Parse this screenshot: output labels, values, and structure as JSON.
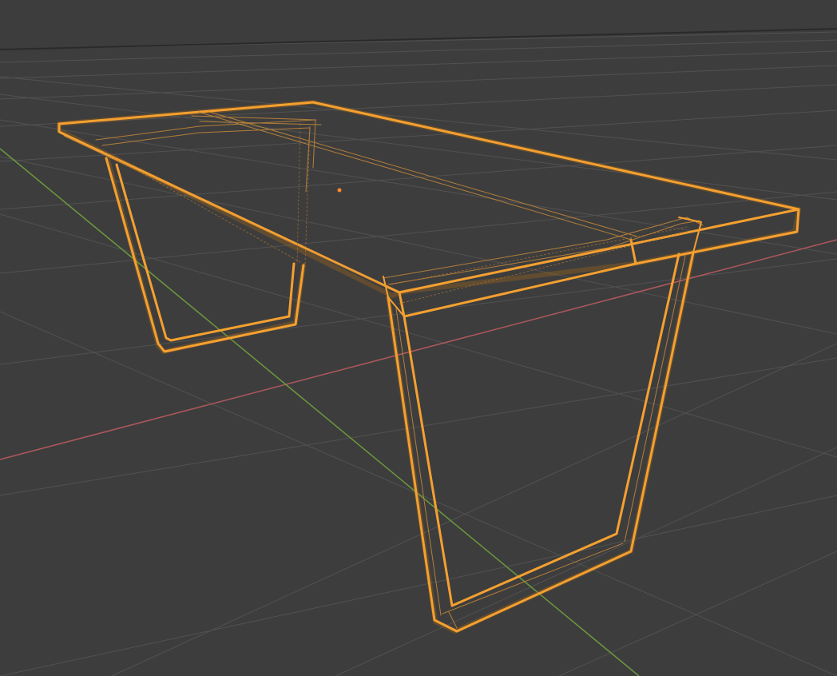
{
  "viewport": {
    "view_mode": "wireframe",
    "background_color": "#3d3d3d",
    "grid_color": "#545454",
    "x_axis_color": "#b0585c",
    "y_axis_color": "#6b9a3c",
    "selection_color": "#f5a030",
    "origin_color": "#ff8a2a"
  },
  "selected_object": {
    "type": "table",
    "selected": true
  }
}
